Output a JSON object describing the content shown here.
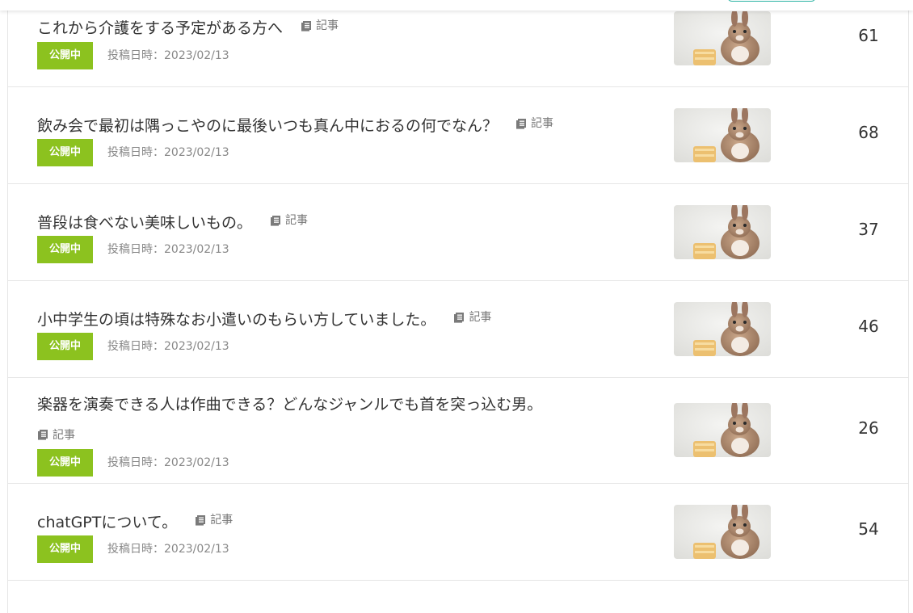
{
  "rows": [
    {
      "title": "これから介護をする予定がある方へ",
      "type_label": "記事",
      "status": "公開中",
      "date": "投稿日時：2023/02/13",
      "views": "61"
    },
    {
      "title": "飲み会で最初は隅っこやのに最後いつも真ん中におるの何でなん？",
      "type_label": "記事",
      "status": "公開中",
      "date": "投稿日時：2023/02/13",
      "views": "68"
    },
    {
      "title": "普段は食べない美味しいもの。",
      "type_label": "記事",
      "status": "公開中",
      "date": "投稿日時：2023/02/13",
      "views": "37"
    },
    {
      "title": "小中学生の頃は特殊なお小遣いのもらい方していました。",
      "type_label": "記事",
      "status": "公開中",
      "date": "投稿日時：2023/02/13",
      "views": "46"
    },
    {
      "title": "楽器を演奏できる人は作曲できる？どんなジャンルでも首を突っ込む男。",
      "type_label": "記事",
      "status": "公開中",
      "date": "投稿日時：2023/02/13",
      "views": "26"
    },
    {
      "title": "chatGPTについて。",
      "type_label": "記事",
      "status": "公開中",
      "date": "投稿日時：2023/02/13",
      "views": "54"
    }
  ],
  "colors": {
    "status_badge": "#8cc21f",
    "divider": "#e6e6e6",
    "accent_top": "#2ab3a3"
  },
  "icons": {
    "type": "document-icon",
    "thumbnail": "rabbit-thumbnail"
  }
}
